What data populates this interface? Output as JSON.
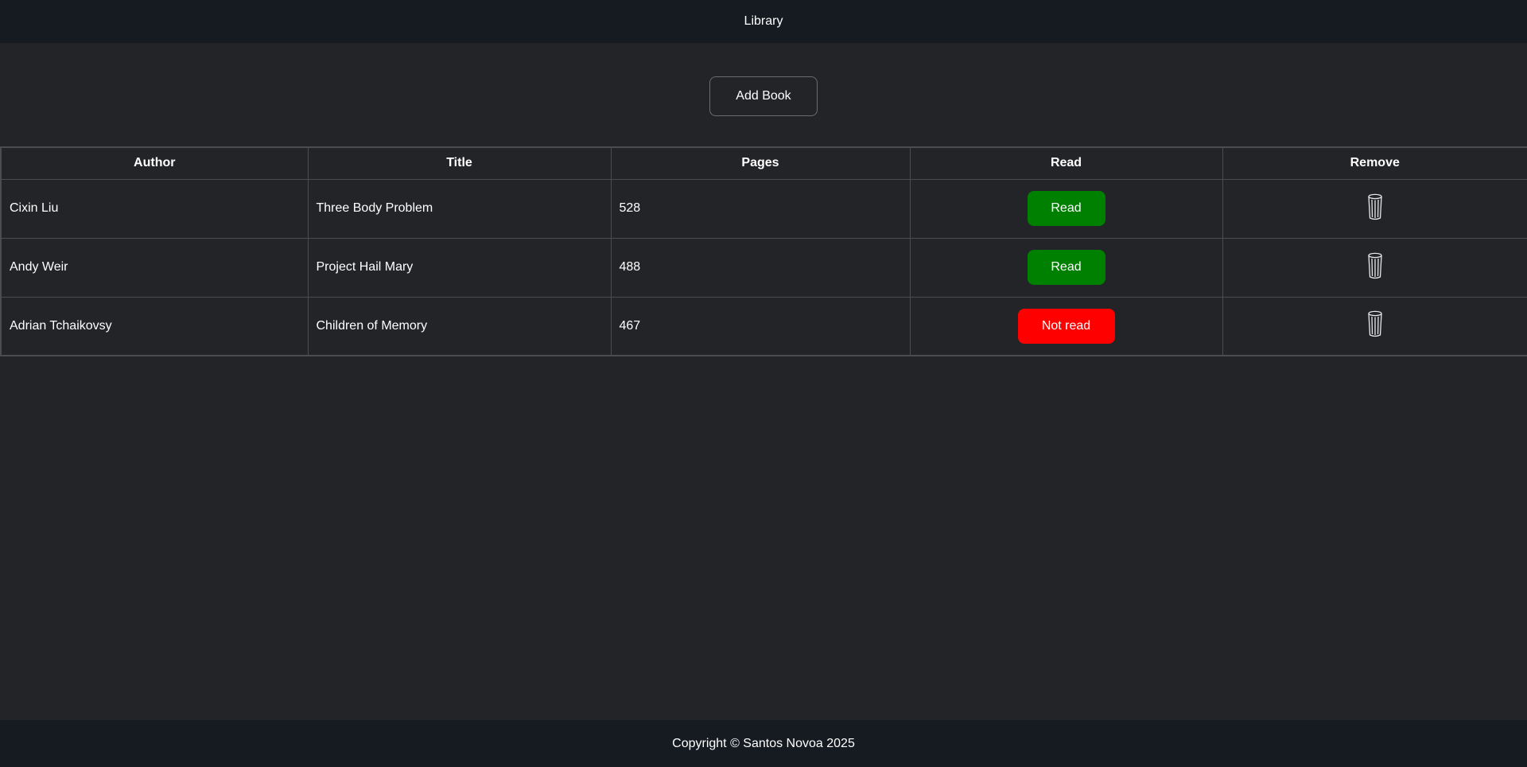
{
  "header": {
    "title": "Library"
  },
  "toolbar": {
    "add_label": "Add Book"
  },
  "table": {
    "columns": [
      "Author",
      "Title",
      "Pages",
      "Read",
      "Remove"
    ],
    "rows": [
      {
        "author": "Cixin Liu",
        "title": "Three Body Problem",
        "pages": "528",
        "read": true,
        "read_label": "Read"
      },
      {
        "author": "Andy Weir",
        "title": "Project Hail Mary",
        "pages": "488",
        "read": true,
        "read_label": "Read"
      },
      {
        "author": "Adrian Tchaikovsy",
        "title": "Children of Memory",
        "pages": "467",
        "read": false,
        "read_label": "Not read"
      }
    ]
  },
  "remove_icon": "trash-icon",
  "colors": {
    "read": "#008000",
    "not_read": "#ff0000",
    "bar": "#161a21",
    "background": "#232428"
  },
  "footer": {
    "copyright": "Copyright © Santos Novoa 2025"
  }
}
